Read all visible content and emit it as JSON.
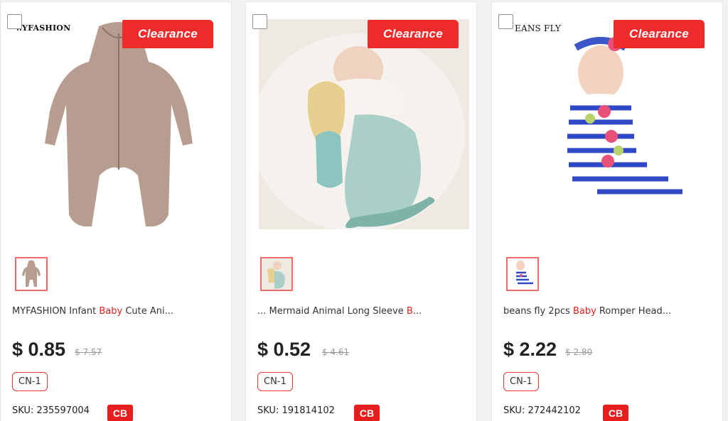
{
  "products": [
    {
      "brand": "..YFASHION",
      "clearance_label": "Clearance",
      "title_prefix": "MYFASHION Infant ",
      "title_highlight": "Baby",
      "title_suffix": " Cute Ani...",
      "price": "$ 0.85",
      "old_price": "$ 7.57",
      "tag": "CN-1",
      "sku": "SKU: 235597004",
      "badge": "CB"
    },
    {
      "brand": "",
      "clearance_label": "Clearance",
      "title_prefix": "... Mermaid Animal Long Sleeve ",
      "title_highlight": "B",
      "title_suffix": "...",
      "price": "$ 0.52",
      "old_price": "$ 4.61",
      "tag": "CN-1",
      "sku": "SKU: 191814102",
      "badge": "CB"
    },
    {
      "brand": "EANS FLY",
      "clearance_label": "Clearance",
      "title_prefix": "beans fly 2pcs ",
      "title_highlight": "Baby",
      "title_suffix": " Romper Head...",
      "price": "$ 2.22",
      "old_price": "$ 2.80",
      "tag": "CN-1",
      "sku": "SKU: 272442102",
      "badge": "CB"
    }
  ],
  "colors": {
    "accent_red": "#ee2b2b",
    "badge_red": "#e81d1d",
    "highlight_red": "#e02020"
  }
}
